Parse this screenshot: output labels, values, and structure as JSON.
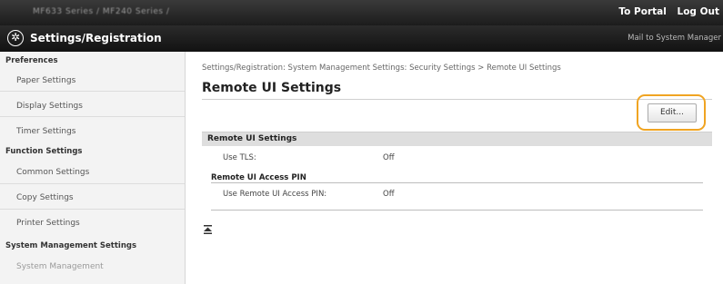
{
  "topbar": {
    "model_text": "MF633 Series / MF240 Series /",
    "to_portal": "To Portal",
    "log_out": "Log Out"
  },
  "titlebar": {
    "icon": "settings-gear-icon",
    "title": "Settings/Registration",
    "mail": "Mail to System Manager"
  },
  "sidebar": {
    "preferences": "Preferences",
    "paper_settings": "Paper Settings",
    "display_settings": "Display Settings",
    "timer_settings": "Timer Settings",
    "function_settings": "Function Settings",
    "common_settings": "Common Settings",
    "copy_settings": "Copy Settings",
    "printer_settings": "Printer Settings",
    "system_management_settings": "System Management Settings",
    "system_management": "System Management"
  },
  "main": {
    "breadcrumb": "Settings/Registration: System Management Settings: Security Settings > Remote UI Settings",
    "page_title": "Remote UI Settings",
    "edit_button": "Edit...",
    "section_title": "Remote UI Settings",
    "use_tls_label": "Use TLS:",
    "use_tls_value": "Off",
    "pin_section_title": "Remote UI Access PIN",
    "use_pin_label": "Use Remote UI Access PIN:",
    "use_pin_value": "Off"
  },
  "colors": {
    "highlight": "#f0a422",
    "header_dark": "#1c1c1c"
  }
}
